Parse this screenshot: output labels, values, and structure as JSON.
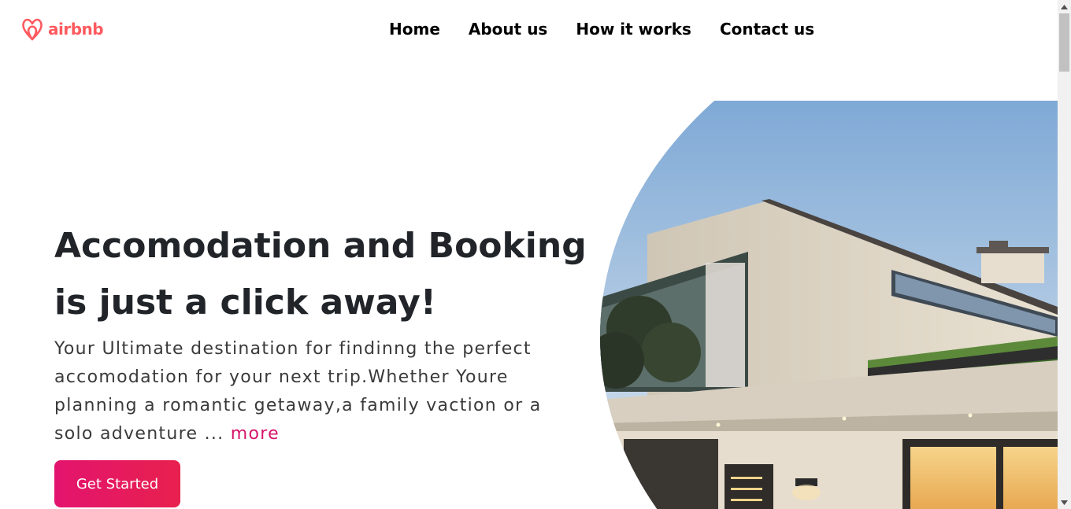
{
  "brand": {
    "name": "airbnb",
    "color": "#FF5A5F",
    "icon": "airbnb-logo-icon"
  },
  "nav": {
    "items": [
      {
        "label": "Home"
      },
      {
        "label": "About us"
      },
      {
        "label": "How it works"
      },
      {
        "label": "Contact us"
      }
    ]
  },
  "hero": {
    "title_line1": "Accomodation and Booking",
    "title_line2": "is just a click away!",
    "description": "Your Ultimate destination for findinng the perfect accomodation for your next trip.Whether Youre planning a romantic getaway,a family vaction or a solo adventure ... ",
    "more_label": "more",
    "cta_label": "Get Started",
    "accent_color": "#E3146E",
    "image": "modern-house-photo"
  },
  "scrollbar": {
    "position": 0.0
  }
}
